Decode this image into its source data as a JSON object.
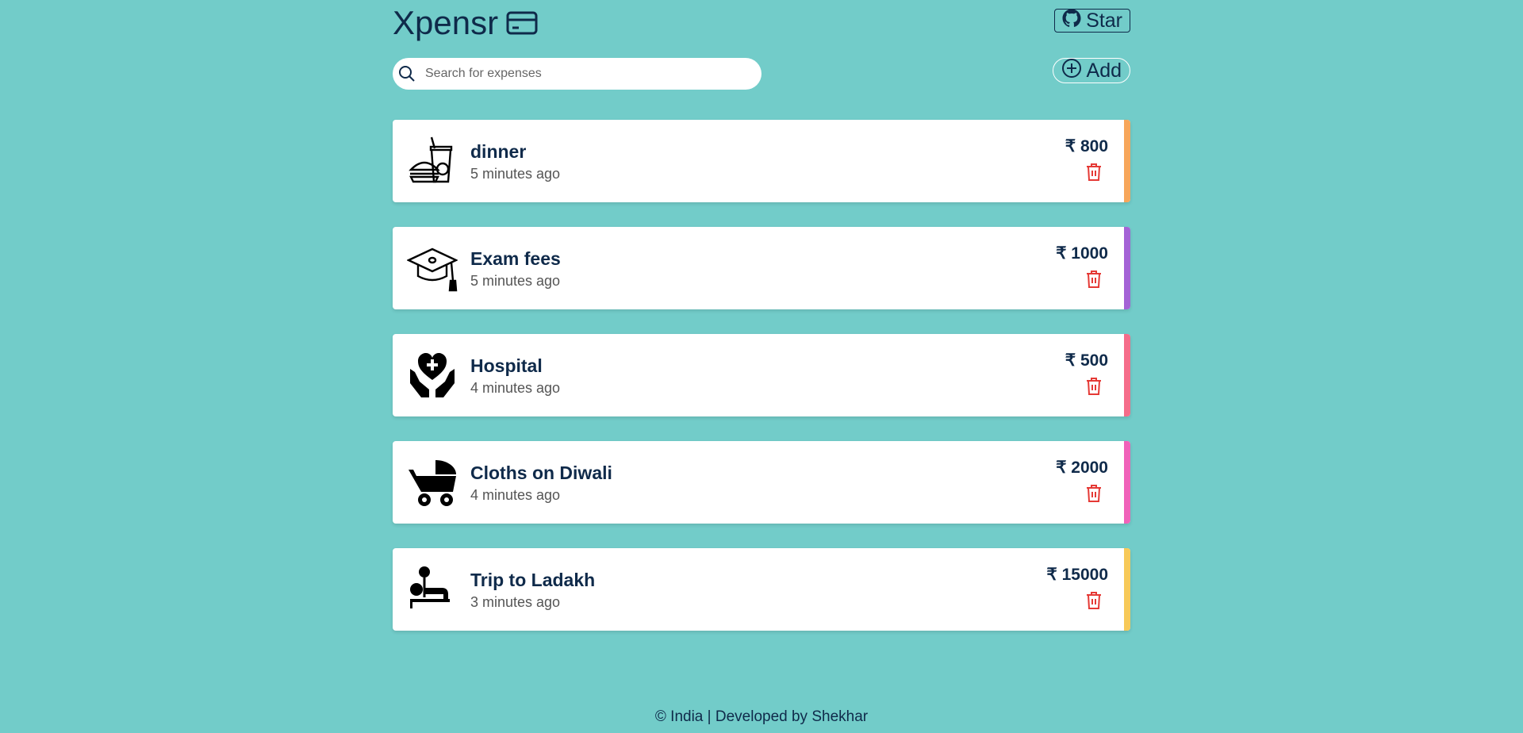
{
  "app": {
    "title": "Xpensr",
    "logo_icon": "credit-card-icon"
  },
  "header": {
    "star_label": "Star",
    "star_icon": "github-icon",
    "add_label": "Add",
    "add_icon": "plus-circle-icon"
  },
  "search": {
    "placeholder": "Search for expenses",
    "value": "",
    "icon": "search-icon"
  },
  "currency_symbol": "₹",
  "expenses": [
    {
      "title": "dinner",
      "time": "5 minutes ago",
      "amount": "₹ 800",
      "icon": "food-drink-icon",
      "color": "#f7a65a"
    },
    {
      "title": "Exam fees",
      "time": "5 minutes ago",
      "amount": "₹ 1000",
      "icon": "graduation-cap-icon",
      "color": "#a463d6"
    },
    {
      "title": "Hospital",
      "time": "4 minutes ago",
      "amount": "₹ 500",
      "icon": "healthcare-hands-icon",
      "color": "#f56d8a"
    },
    {
      "title": "Cloths on Diwali",
      "time": "4 minutes ago",
      "amount": "₹ 2000",
      "icon": "baby-stroller-icon",
      "color": "#f062b9"
    },
    {
      "title": "Trip to Ladakh",
      "time": "3 minutes ago",
      "amount": "₹ 15000",
      "icon": "exercise-icon",
      "color": "#f7c958"
    }
  ],
  "colors": {
    "background": "#72ccc9",
    "text": "#0f2a4a",
    "delete": "#e53935"
  },
  "footer": {
    "text": "© India | Developed by Shekhar"
  }
}
